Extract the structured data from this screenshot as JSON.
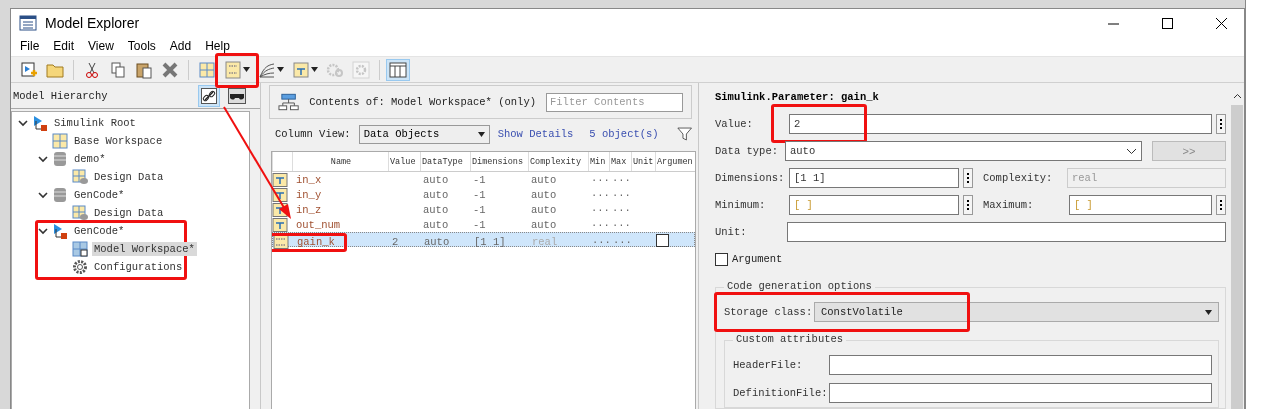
{
  "window": {
    "title": "Model Explorer"
  },
  "menu": [
    "File",
    "Edit",
    "View",
    "Tools",
    "Add",
    "Help"
  ],
  "toolbar": [
    {
      "kind": "add-model",
      "disabled": false
    },
    {
      "kind": "open",
      "disabled": false
    },
    {
      "kind": "sep"
    },
    {
      "kind": "cut",
      "disabled": false
    },
    {
      "kind": "copy",
      "disabled": false
    },
    {
      "kind": "paste",
      "disabled": false
    },
    {
      "kind": "delete",
      "disabled": false
    },
    {
      "kind": "sep"
    },
    {
      "kind": "workspace",
      "disabled": false
    },
    {
      "kind": "parameter",
      "disabled": false,
      "highlighted": true,
      "dropdown": true
    },
    {
      "kind": "signal-lines",
      "disabled": false,
      "dropdown": true
    },
    {
      "kind": "port",
      "disabled": false,
      "dropdown": true
    },
    {
      "kind": "gear",
      "disabled": true
    },
    {
      "kind": "gear-small",
      "disabled": true
    },
    {
      "kind": "sep"
    },
    {
      "kind": "columns",
      "disabled": false,
      "selected": true
    }
  ],
  "hierarchy": {
    "title": "Model Hierarchy",
    "link_on": true,
    "tree": [
      {
        "label": "Simulink Root",
        "kind": "model",
        "expanded": true,
        "selected": false,
        "children": [
          {
            "label": "Base Workspace",
            "kind": "workspace",
            "selected": false
          },
          {
            "label": "demo*",
            "kind": "dictionary",
            "expanded": true,
            "selected": false,
            "children": [
              {
                "label": "Design Data",
                "kind": "design-data",
                "selected": false
              }
            ]
          },
          {
            "label": "GenCode*",
            "kind": "dictionary",
            "expanded": true,
            "selected": false,
            "children": [
              {
                "label": "Design Data",
                "kind": "design-data",
                "selected": false
              }
            ]
          },
          {
            "label": "GenCode*",
            "kind": "model",
            "expanded": true,
            "selected": false,
            "highlighted": true,
            "children": [
              {
                "label": "Model Workspace*",
                "kind": "model-workspace",
                "selected": true
              },
              {
                "label": "Configurations",
                "kind": "gear",
                "selected": false
              }
            ]
          }
        ]
      }
    ]
  },
  "contents": {
    "title": "Contents of: Model Workspace* (only)",
    "filter_placeholder": "Filter Contents",
    "column_view_label": "Column View:",
    "column_view": "Data Objects",
    "show_details": "Show Details",
    "count": "5 object(s)",
    "columns": [
      "Name",
      "Value",
      "DataType",
      "Dimensions",
      "Complexity",
      "Min",
      "Max",
      "Unit",
      "Argumen"
    ],
    "rows": [
      {
        "kind": "signal",
        "name": "in_x",
        "value": "",
        "datatype": "auto",
        "dimensions": "-1",
        "complexity": "auto",
        "min": "···",
        "max": "···",
        "selected": false
      },
      {
        "kind": "signal",
        "name": "in_y",
        "value": "",
        "datatype": "auto",
        "dimensions": "-1",
        "complexity": "auto",
        "min": "···",
        "max": "···",
        "selected": false
      },
      {
        "kind": "signal",
        "name": "in_z",
        "value": "",
        "datatype": "auto",
        "dimensions": "-1",
        "complexity": "auto",
        "min": "···",
        "max": "···",
        "selected": false
      },
      {
        "kind": "signal",
        "name": "out_num",
        "value": "",
        "datatype": "auto",
        "dimensions": "-1",
        "complexity": "auto",
        "min": "···",
        "max": "···",
        "selected": false
      },
      {
        "kind": "parameter",
        "name": "gain_k",
        "value": "2",
        "datatype": "auto",
        "dimensions": "[1 1]",
        "complexity": "real",
        "min": "···",
        "max": "···",
        "selected": true,
        "highlighted": true,
        "argument": false
      }
    ]
  },
  "properties": {
    "title": "Simulink.Parameter: gain_k",
    "value_label": "Value:",
    "value": "2",
    "value_highlighted": true,
    "datatype_label": "Data type:",
    "datatype": "auto",
    "datatype_button": ">>",
    "dimensions_label": "Dimensions:",
    "dimensions": "[1 1]",
    "complexity_label": "Complexity:",
    "complexity": "real",
    "minimum_label": "Minimum:",
    "minimum": "[ ]",
    "maximum_label": "Maximum:",
    "maximum": "[ ]",
    "unit_label": "Unit:",
    "argument_label": "Argument",
    "argument": false,
    "codegen_title": "Code generation options",
    "storage_label": "Storage class:",
    "storage": "ConstVolatile",
    "storage_highlighted": true,
    "custom_title": "Custom attributes",
    "custom_fields": [
      "HeaderFile:",
      "DefinitionFile:"
    ]
  }
}
